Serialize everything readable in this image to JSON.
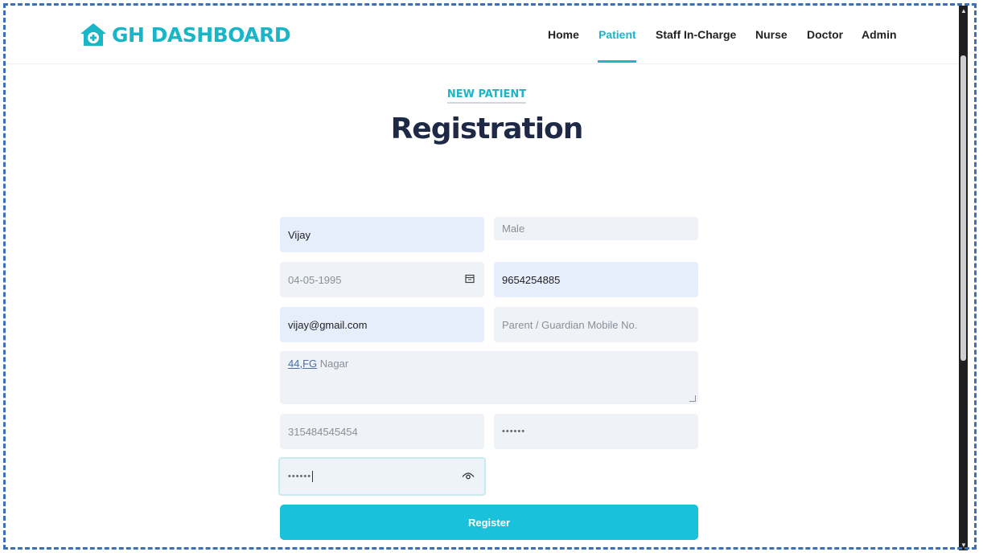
{
  "brand": {
    "name": "GH DASHBOARD",
    "color": "#1ab5c7"
  },
  "nav": {
    "items": [
      {
        "label": "Home",
        "active": false
      },
      {
        "label": "Patient",
        "active": true
      },
      {
        "label": "Staff In-Charge",
        "active": false
      },
      {
        "label": "Nurse",
        "active": false
      },
      {
        "label": "Doctor",
        "active": false
      },
      {
        "label": "Admin",
        "active": false
      }
    ]
  },
  "page": {
    "subtitle": "NEW PATIENT",
    "title": "Registration"
  },
  "form": {
    "name": {
      "value": "Vijay"
    },
    "gender": {
      "placeholder": "Male"
    },
    "dob": {
      "value": "04-05-1995",
      "icon": "calendar-icon"
    },
    "mobile": {
      "value": "9654254885"
    },
    "email": {
      "value": "vijay@gmail.com"
    },
    "guardian_mobile": {
      "placeholder": "Parent / Guardian Mobile No."
    },
    "address": {
      "link_part": "44,FG",
      "rest": " Nagar"
    },
    "aadhaar": {
      "value": "315484545454"
    },
    "password": {
      "value": "••••••"
    },
    "confirm_password": {
      "value": "••••••",
      "icon": "eye-icon"
    },
    "register_label": "Register"
  }
}
